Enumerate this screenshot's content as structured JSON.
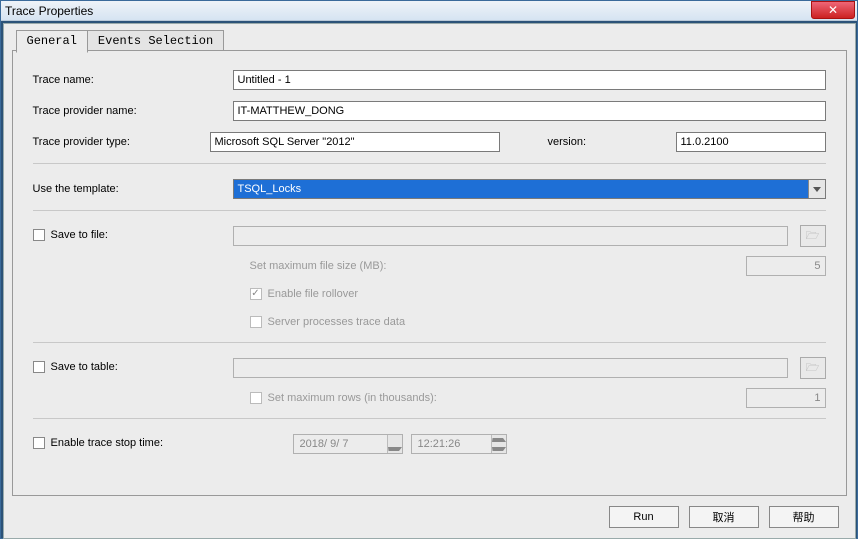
{
  "window": {
    "title": "Trace Properties"
  },
  "tabs": {
    "general": "General",
    "events": "Events Selection"
  },
  "labels": {
    "trace_name": "Trace name:",
    "provider_name": "Trace provider name:",
    "provider_type": "Trace provider type:",
    "version": "version:",
    "use_template": "Use the template:",
    "save_to_file": "Save to file:",
    "max_file_size": "Set maximum file size (MB):",
    "enable_rollover": "Enable file rollover",
    "server_processes": "Server processes trace data",
    "save_to_table": "Save to table:",
    "max_rows": "Set maximum rows (in thousands):",
    "enable_stop": "Enable trace stop time:"
  },
  "values": {
    "trace_name": "Untitled - 1",
    "provider_name": "IT-MATTHEW_DONG",
    "provider_type": "Microsoft SQL Server \"2012\"",
    "version": "11.0.2100",
    "template": "TSQL_Locks",
    "max_file_size": "5",
    "max_rows": "1",
    "stop_date": "2018/ 9/ 7",
    "stop_time": "12:21:26"
  },
  "buttons": {
    "run": "Run",
    "cancel": "取消",
    "help": "帮助"
  }
}
